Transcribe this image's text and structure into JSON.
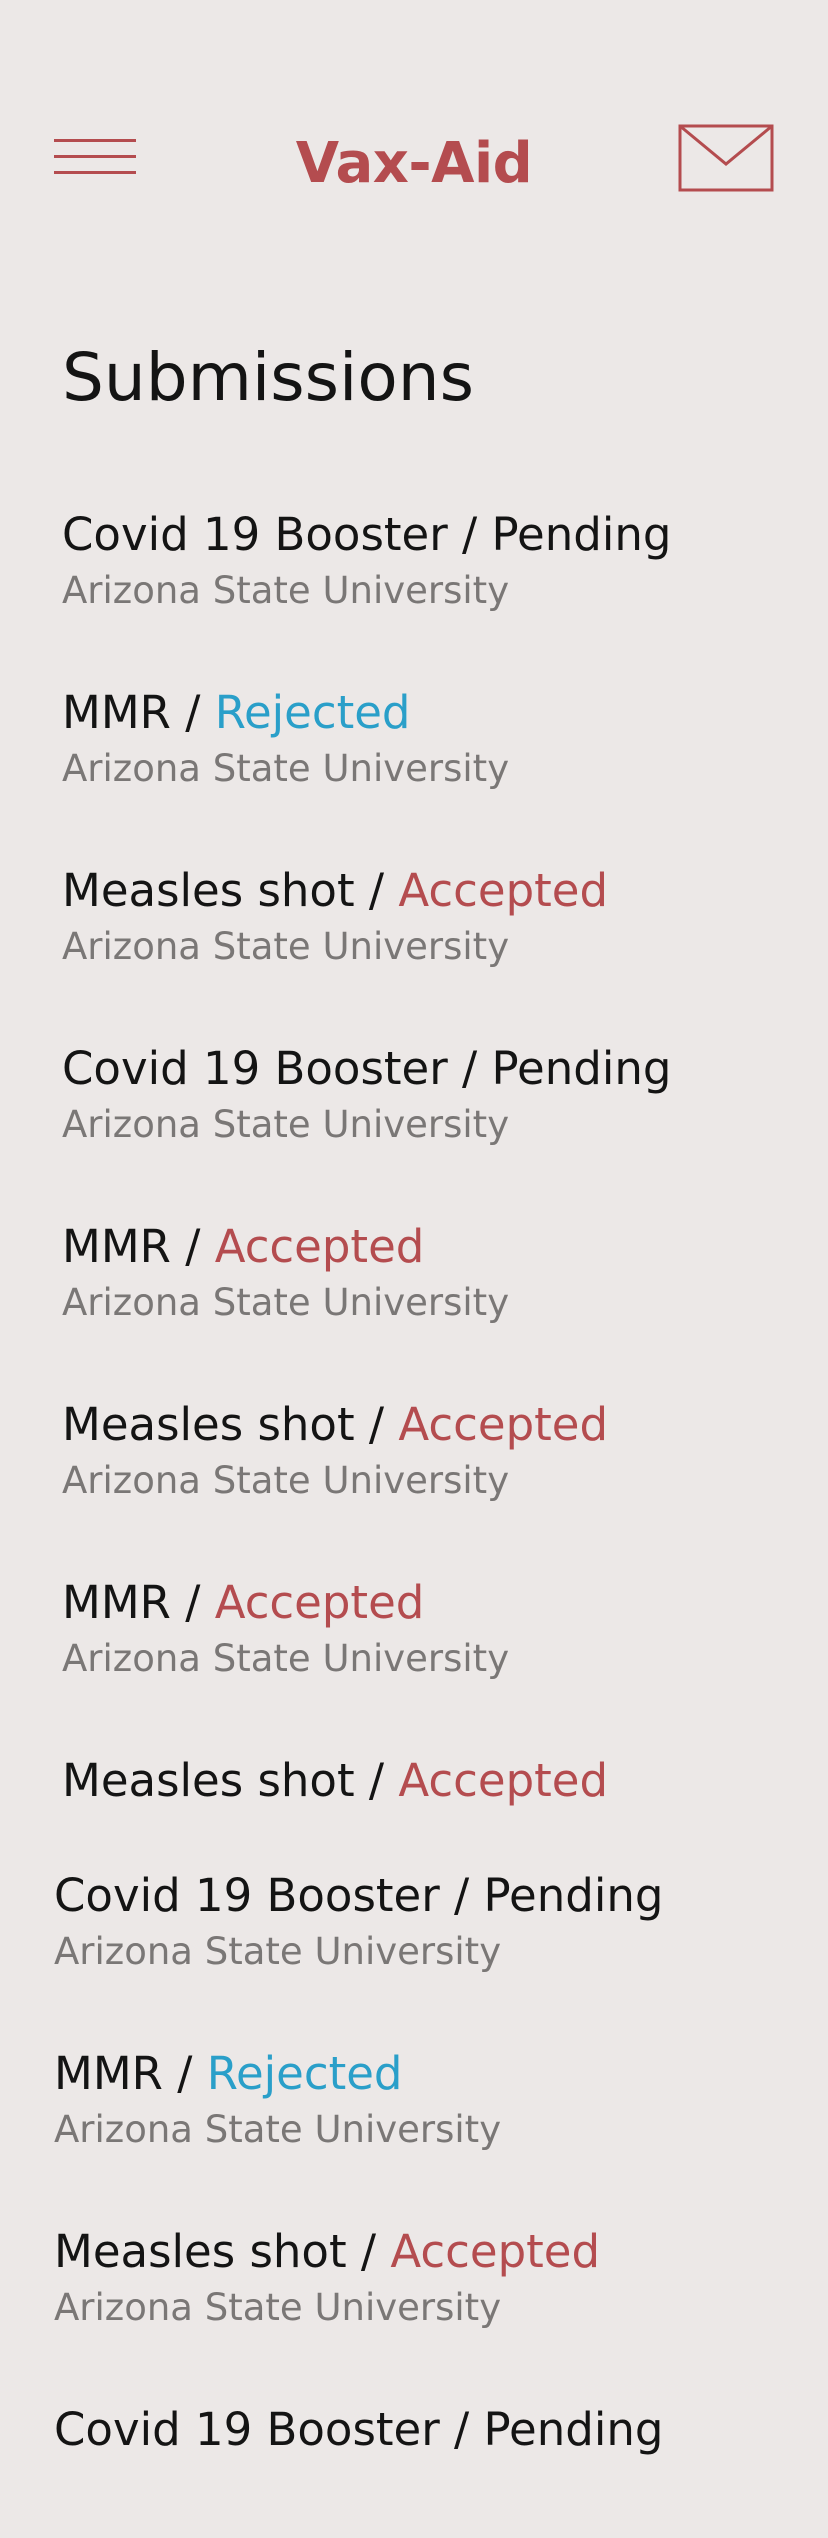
{
  "header": {
    "app_title": "Vax-Aid"
  },
  "page": {
    "title": "Submissions"
  },
  "colors": {
    "brand": "#b44c4f",
    "rejected": "#2a9fc9",
    "pending": "#141414",
    "subtext": "#7a7776",
    "background": "#ece8e7"
  },
  "submissions": [
    {
      "vaccine": "Covid 19 Booster",
      "separator": " / ",
      "status": "Pending",
      "status_type": "pending",
      "institution": "Arizona State University"
    },
    {
      "vaccine": "MMR",
      "separator": " / ",
      "status": "Rejected",
      "status_type": "rejected",
      "institution": "Arizona State University"
    },
    {
      "vaccine": "Measles shot",
      "separator": " / ",
      "status": "Accepted",
      "status_type": "accepted",
      "institution": "Arizona State University"
    },
    {
      "vaccine": "Covid 19 Booster",
      "separator": " / ",
      "status": "Pending",
      "status_type": "pending",
      "institution": "Arizona State University"
    },
    {
      "vaccine": "MMR",
      "separator": " / ",
      "status": "Accepted",
      "status_type": "accepted",
      "institution": "Arizona State University"
    },
    {
      "vaccine": "Measles shot",
      "separator": " / ",
      "status": "Accepted",
      "status_type": "accepted",
      "institution": "Arizona State University"
    },
    {
      "vaccine": "MMR",
      "separator": " / ",
      "status": "Accepted",
      "status_type": "accepted",
      "institution": "Arizona State University"
    },
    {
      "vaccine": "Measles shot",
      "separator": " / ",
      "status": "Accepted",
      "status_type": "accepted",
      "institution": ""
    },
    {
      "vaccine": "Covid 19 Booster",
      "separator": " / ",
      "status": "Pending",
      "status_type": "pending",
      "institution": "Arizona State University"
    },
    {
      "vaccine": "MMR",
      "separator": " / ",
      "status": "Rejected",
      "status_type": "rejected",
      "institution": "Arizona State University"
    },
    {
      "vaccine": "Measles shot",
      "separator": " / ",
      "status": "Accepted",
      "status_type": "accepted",
      "institution": "Arizona State University"
    },
    {
      "vaccine": "Covid 19 Booster",
      "separator": " / ",
      "status": "Pending",
      "status_type": "pending",
      "institution": ""
    }
  ]
}
